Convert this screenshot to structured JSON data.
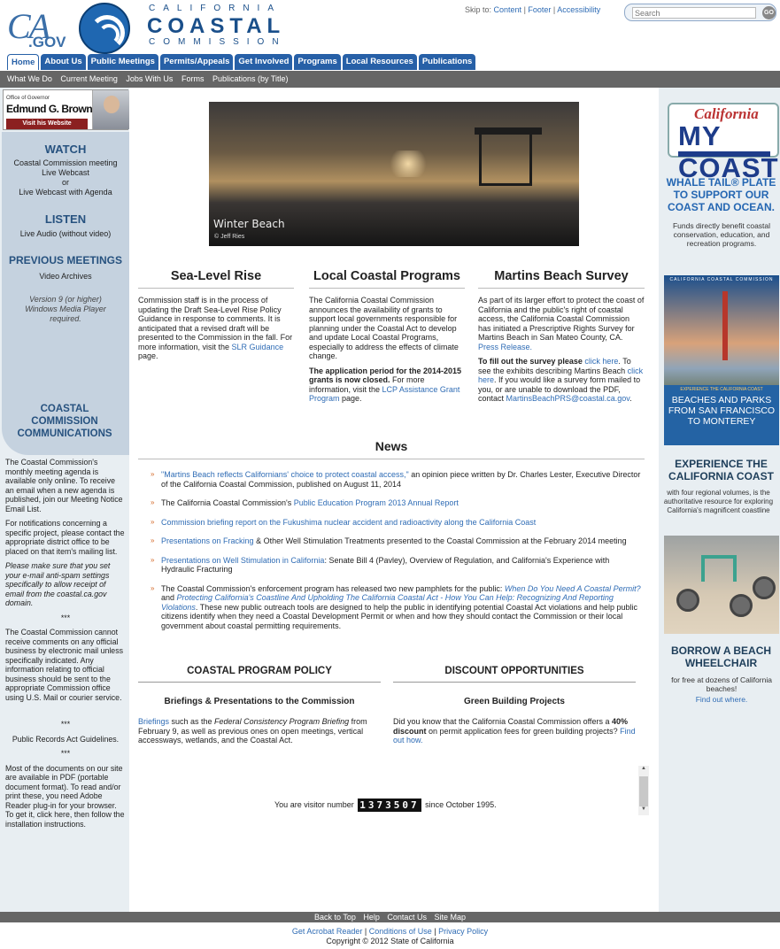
{
  "header": {
    "logo_ca": "CA",
    "logo_gov": ".GOV",
    "title_line1": "CALIFORNIA",
    "title_line2": "COASTAL",
    "title_line3": "COMMISSION",
    "skip_label": "Skip to:",
    "skip_content": "Content",
    "skip_footer": "Footer",
    "skip_access": "Accessibility",
    "search_placeholder": "Search",
    "go": "GO"
  },
  "tabs": [
    "Home",
    "About Us",
    "Public Meetings",
    "Permits/Appeals",
    "Get Involved",
    "Programs",
    "Local Resources",
    "Publications"
  ],
  "subnav": [
    "What We Do",
    "Current Meeting",
    "Jobs With Us",
    "Forms",
    "Publications (by Title)"
  ],
  "governor": {
    "office": "Office of Governor",
    "name": "Edmund G. Brown Jr.",
    "visit": "Visit his Website"
  },
  "left": {
    "watch": "WATCH",
    "watch_1": "Coastal Commission meeting",
    "watch_2": "Live Webcast",
    "watch_or": "or",
    "watch_3": "Live Webcast with Agenda",
    "listen": "LISTEN",
    "listen_1": "Live Audio (without video)",
    "prev": "PREVIOUS MEETINGS",
    "prev_1": "Video Archives",
    "prev_note": "Version 9 (or higher) Windows Media Player required.",
    "comm_title": "COASTAL COMMISSION COMMUNICATIONS",
    "p1": "The Coastal Commission's monthly meeting agenda is available only online. To receive an email when a new agenda is published, join our Meeting Notice Email List.",
    "p2": "For notifications concerning a specific project, please contact the appropriate district office to be placed on that item's mailing list.",
    "p3": "Please make sure that you set your e-mail anti-spam settings specifically to allow receipt of email from the coastal.ca.gov domain.",
    "stars": "***",
    "p4": "The Coastal Commission cannot receive comments on any official business by electronic mail unless specifically indicated. Any information relating to official business should be sent to the appropriate Commission office using U.S. Mail or courier service.",
    "pra": "Public Records Act Guidelines.",
    "p5": "Most of the documents on our site are available in PDF (portable document format). To read and/or print these, you need Adobe Reader plug-in for your browser. To get it, click here, then follow the installation instructions."
  },
  "hero": {
    "caption": "Winter Beach",
    "credit": "© Jeff Ries"
  },
  "cols": {
    "slr_title": "Sea-Level Rise",
    "slr_text": "Commission staff is in the process of updating the Draft Sea-Level Rise Policy Guidance in response to comments. It is anticipated that a revised draft will be presented to the Commission in the fall. For more information, visit the ",
    "slr_link": "SLR Guidance",
    "slr_end": " page.",
    "lcp_title": "Local Coastal Programs",
    "lcp_text": "The California Coastal Commission announces the availability of grants to support local governments responsible for planning under the Coastal Act to develop and update Local Coastal Programs, especially to address the effects of climate change.",
    "lcp_bold": "The application period for the 2014-2015 grants is now closed.",
    "lcp_more": " For more information, visit the ",
    "lcp_link": "LCP Assistance Grant Program",
    "lcp_end": " page.",
    "mbs_title": "Martins Beach Survey",
    "mbs_text": "As part of its larger effort to protect the coast of California and the public's right of coastal access, the California Coastal Commission has initiated a Prescriptive Rights Survey for Martins Beach in San Mateo County, CA. ",
    "mbs_link": "Press Release.",
    "mbs_bold": "To fill out the survey please ",
    "mbs_here": "click here",
    "mbs_rest1": ". To see the exhibits describing Martins Beach ",
    "mbs_here2": "click here",
    "mbs_rest2": ". If you would like a survey form mailed to you, or are unable to download the PDF, contact ",
    "mbs_email": "MartinsBeachPRS@coastal.ca.gov",
    "mbs_dot": "."
  },
  "news": {
    "title": "News",
    "items": [
      {
        "link": "\"Martins Beach reflects Californians' choice to protect coastal access,\"",
        "text": " an opinion piece written by Dr. Charles Lester, Executive Director of the California Coastal Commission, published on August 11, 2014"
      },
      {
        "pre": "The California Coastal Commission's ",
        "link": "Public Education Program 2013 Annual Report"
      },
      {
        "link": "Commission briefing report on the Fukushima nuclear accident and radioactivity along the California Coast"
      },
      {
        "link": "Presentations on Fracking",
        "text": " & Other Well Stimulation Treatments presented to the Coastal Commission at the February 2014 meeting"
      },
      {
        "link": "Presentations on Well Stimulation in California",
        "text": ": Senate Bill 4 (Pavley), Overview of Regulation, and California's Experience with Hydraulic Fracturing"
      },
      {
        "pre": "The Coastal Commission's enforcement program has released two new pamphlets for the public: ",
        "link": "When Do You Need A Coastal Permit?",
        "and": " and ",
        "link2": "Protecting California's Coastline And Upholding The California Coastal Act - How You Can Help: Recognizing And Reporting Violations",
        "text": ". These new public outreach tools are designed to help the public in identifying potential Coastal Act violations and help public citizens identify when they need a Coastal Development Permit or when and how they should contact the Commission or their local government about coastal permitting requirements."
      }
    ]
  },
  "lower": {
    "policy": "COASTAL PROGRAM POLICY",
    "policy_sub": "Briefings & Presentations to the Commission",
    "policy_link": "Briefings",
    "policy_text1": " such as the ",
    "policy_it": "Federal Consistency Program Briefing",
    "policy_text2": " from February 9, as well as previous ones on open meetings, vertical accessways, wetlands, and the Coastal Act.",
    "disc": "DISCOUNT OPPORTUNITIES",
    "disc_sub": "Green Building Projects",
    "disc_text": "Did you know that the California Coastal Commission offers a ",
    "disc_bold": "40% discount",
    "disc_text2": " on permit application fees for green building projects? ",
    "disc_link": "Find out how."
  },
  "visitor": {
    "pre": "You are visitor number",
    "count": "1373507",
    "post": "since October 1995."
  },
  "right": {
    "plate_c": "California",
    "plate_m": "MY COAST",
    "whale": "WHALE TAIL® PLATE TO SUPPORT OUR COAST AND OCEAN.",
    "whale_text": "Funds directly benefit coastal conservation, education, and recreation programs.",
    "bridge_cap": "CALIFORNIA COASTAL COMMISSION",
    "bridge_sub": "EXPERIENCE THE CALIFORNIA COAST",
    "bridge_title": "BEACHES AND PARKS FROM SAN FRANCISCO TO MONTEREY",
    "exp": "EXPERIENCE THE CALIFORNIA COAST",
    "exp_text": "with four regional volumes, is the authoritative resource for exploring California's magnificent coastline",
    "borrow": "BORROW A BEACH WHEELCHAIR",
    "borrow_text": "for free at dozens of California beaches!",
    "borrow_link": "Find out where."
  },
  "footer": {
    "links": [
      "Back to Top",
      "Help",
      "Contact Us",
      "Site Map"
    ],
    "acrobat": "Get Acrobat Reader",
    "conditions": "Conditions of Use",
    "privacy": "Privacy Policy",
    "copyright": "Copyright © 2012 State of California"
  }
}
